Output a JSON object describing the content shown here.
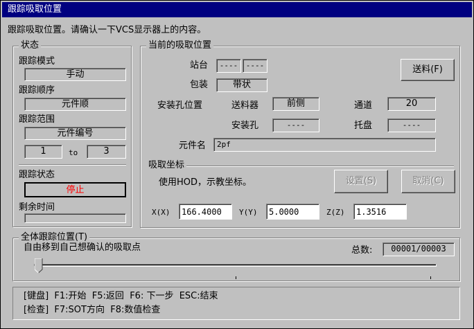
{
  "window": {
    "title": "跟踪吸取位置"
  },
  "instruction": "跟踪吸取位置。请确认一下VCS显示器上的内容。",
  "status": {
    "legend": "状态",
    "mode_label": "跟踪模式",
    "mode_value": "手动",
    "order_label": "跟踪顺序",
    "order_value": "元件顺",
    "range_label": "跟踪范围",
    "range_value": "元件编号",
    "range_from": "1",
    "range_to_label": "to",
    "range_to": "3",
    "state_label": "跟踪状态",
    "state_value": "停止",
    "state_color": "#ff0000",
    "remaining_label": "剩余时间",
    "remaining_value": ""
  },
  "current_pick": {
    "legend": "当前的吸取位置",
    "station_label": "站台",
    "station_a": "----",
    "station_b": "----",
    "feed_button": "送料(F)",
    "package_label": "包装",
    "package_value": "带状",
    "mount_hole_label": "安装孔位置",
    "feeder_label": "送料器",
    "feeder_value": "前侧",
    "channel_label": "通道",
    "channel_value": "20",
    "hole_label": "安装孔",
    "hole_value": "----",
    "tray_label": "托盘",
    "tray_value": "----",
    "part_name_label": "元件名",
    "part_name_value": "2pf"
  },
  "pick_coord": {
    "legend": "吸取坐标",
    "note": "使用HOD，示教坐标。",
    "set_button": "设置(S)",
    "cancel_button": "取消(C)",
    "x_label": "X(X)",
    "x_value": "166.4000",
    "y_label": "Y(Y)",
    "y_value": "5.0000",
    "z_label": "Z(Z)",
    "z_value": "1.3516"
  },
  "global_track": {
    "legend": "全体跟踪位置(T)",
    "hint": "自由移到自己想确认的吸取点",
    "total_label": "总数:",
    "total_value": "00001/00003",
    "slider_position": 0
  },
  "keys": {
    "line1": "[键盘]  F1:开始  F5:返回  F6: 下一步  ESC:结束",
    "line2": "[检查]  F7:SOT方向  F8:数值检查"
  }
}
